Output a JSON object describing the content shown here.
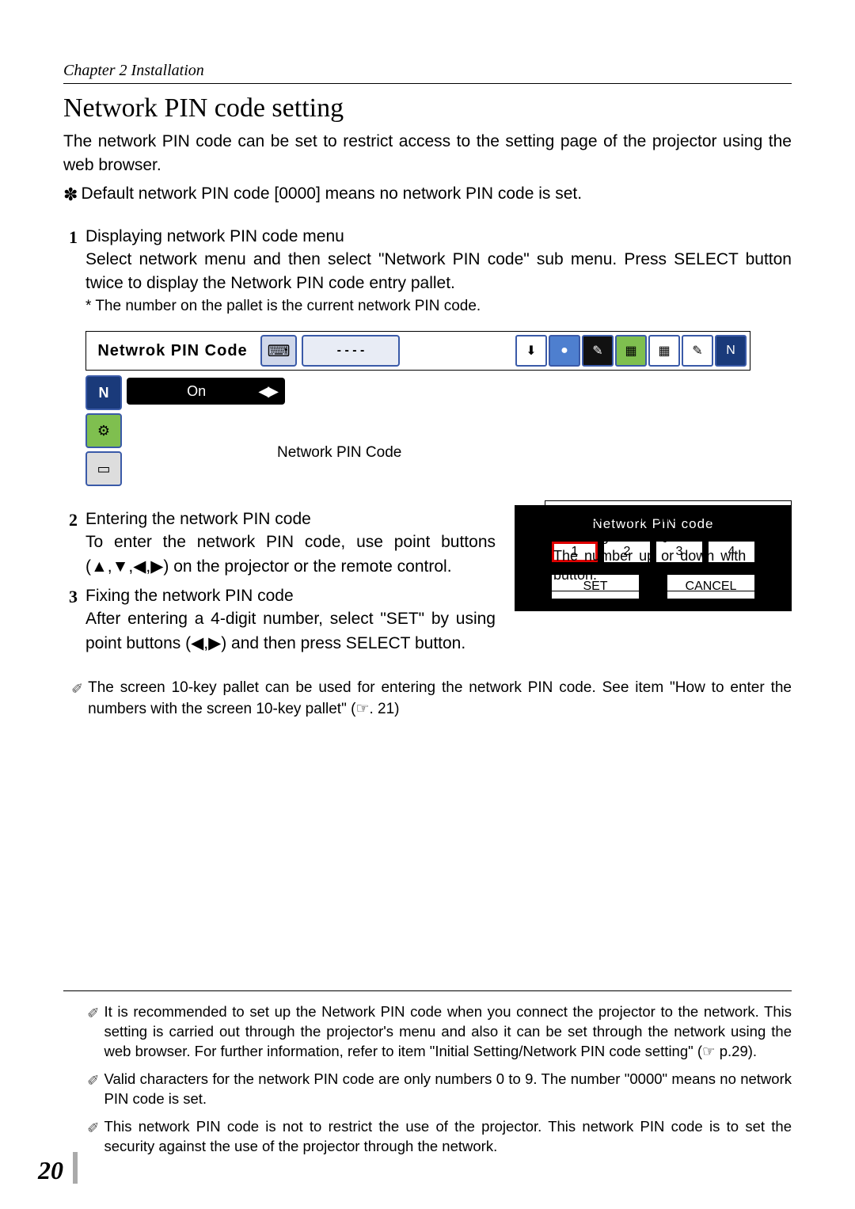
{
  "chapter": "Chapter 2 Installation",
  "title": "Network PIN code setting",
  "intro": "The network PIN code can be set to restrict access to the setting page of the projector using the web browser.",
  "default_note": "Default network PIN code [0000] means no network PIN code is set.",
  "step1": {
    "num": "1",
    "title": "Displaying network PIN code menu",
    "body": "Select network menu and then select \"Network PIN code\" sub menu. Press SELECT button twice to display the Network PIN code entry pallet.",
    "subnote": "* The number on the pallet is the current network PIN code."
  },
  "menubar_label": "Netwrok PIN Code",
  "dashes": "- - - -",
  "on_label": "On",
  "pin_caption": "Network PIN Code",
  "info_box": {
    "line1": "The red frame moves sequentially left or right with ◀▶ button.",
    "line2": "The number up or down with ▼▲ button."
  },
  "step2": {
    "num": "2",
    "title": "Entering the network PIN code",
    "body": "To enter the network PIN code, use point buttons (▲,▼,◀,▶) on the projector or the remote control."
  },
  "step3": {
    "num": "3",
    "title": "Fixing the network PIN code",
    "body": "After entering a 4-digit number, select \"SET\" by using point buttons (◀,▶) and then press SELECT button."
  },
  "pallet": {
    "title": "Network PIN code",
    "digits": [
      "1",
      "2",
      "3",
      "4"
    ],
    "set": "SET",
    "cancel": "CANCEL"
  },
  "note10key": "The screen 10-key pallet can be used for entering the network PIN code. See item \"How to enter the numbers with the screen 10-key pallet\" (☞. 21)",
  "foot1": "It is recommended to set up the Network PIN code when you connect the projector to the network. This setting is carried out through the projector's menu and also it can be set through the network using the web browser. For further information, refer to item \"Initial Setting/Network PIN code setting\" (☞ p.29).",
  "foot2": "Valid characters for the network PIN code are only numbers 0 to 9. The number \"0000\" means no network PIN code is set.",
  "foot3": "This network PIN code is not to restrict the use of the projector. This network PIN code is to set the security against the use of the projector through the network.",
  "page_num": "20"
}
